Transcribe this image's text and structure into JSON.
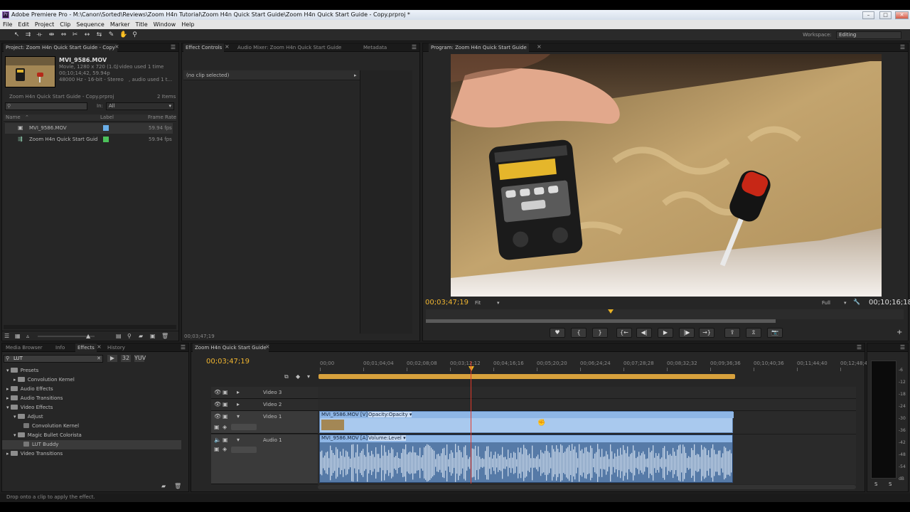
{
  "window": {
    "title": "Adobe Premiere Pro - M:\\Canon\\Sorted\\Reviews\\Zoom H4n Tutorial\\Zoom H4n Quick Start Guide\\Zoom H4n Quick Start Guide - Copy.prproj *",
    "controls": [
      "–",
      "□",
      "✕"
    ]
  },
  "menu": [
    "File",
    "Edit",
    "Project",
    "Clip",
    "Sequence",
    "Marker",
    "Title",
    "Window",
    "Help"
  ],
  "toolbar": {
    "tools": [
      "selection-tool-icon",
      "track-select-icon",
      "ripple-edit-icon",
      "rolling-edit-icon",
      "rate-stretch-icon",
      "razor-icon",
      "slip-icon",
      "slide-icon",
      "pen-icon",
      "hand-icon",
      "zoom-icon"
    ],
    "workspace_label": "Workspace:",
    "workspace_value": "Editing"
  },
  "project": {
    "tab": "Project: Zoom H4n Quick Start Guide - Copy",
    "clip_name": "MVI_9586.MOV",
    "clip_line1": "Movie, 1280 x 720 (1.0)",
    "clip_line1b": ", video used 1 time",
    "clip_line2": "00;10;14;42, 59.94p",
    "clip_line3": "48000 Hz - 16-bit - Stereo",
    "clip_line3b": ", audio used 1 t...",
    "file_name": "Zoom H4n Quick Start Guide - Copy.prproj",
    "item_count": "2 Items",
    "in_label": "In:",
    "in_value": "All",
    "col_name": "Name",
    "col_label": "Label",
    "col_rate": "Frame Rate",
    "items": [
      {
        "name": "MVI_9586.MOV",
        "rate": "59.94 fps",
        "color": "#6aaee8"
      },
      {
        "name": "Zoom H4n Quick Start Guid",
        "rate": "59.94 fps",
        "color": "#4cc15a"
      }
    ]
  },
  "effect_controls": {
    "tabs": [
      "Effect Controls",
      "Audio Mixer: Zoom H4n Quick Start Guide",
      "Metadata"
    ],
    "no_clip": "(no clip selected)",
    "timecode": "00;03;47;19"
  },
  "program": {
    "tab": "Program: Zoom H4n Quick Start Guide",
    "timecode": "00;03;47;19",
    "fit": "Fit",
    "quality": "Full",
    "duration": "00;10;16;18",
    "transport": [
      "♥",
      "{",
      "}",
      "{←",
      "◀|",
      "▶",
      "|▶",
      "→}",
      "⇪",
      "⇫",
      "📷"
    ]
  },
  "effects": {
    "tabs": [
      "Media Browser",
      "Info",
      "Effects",
      "History"
    ],
    "search": "LUT",
    "tree": [
      {
        "label": "Presets",
        "level": 0,
        "open": true
      },
      {
        "label": "Convolution Kernel",
        "level": 1,
        "open": false
      },
      {
        "label": "Audio Effects",
        "level": 0,
        "open": false
      },
      {
        "label": "Audio Transitions",
        "level": 0,
        "open": false
      },
      {
        "label": "Video Effects",
        "level": 0,
        "open": true
      },
      {
        "label": "Adjust",
        "level": 1,
        "open": true
      },
      {
        "label": "Convolution Kernel",
        "level": 2,
        "open": false
      },
      {
        "label": "Magic Bullet Colorista",
        "level": 1,
        "open": true
      },
      {
        "label": "LUT Buddy",
        "level": 2,
        "open": false
      },
      {
        "label": "Video Transitions",
        "level": 0,
        "open": false
      }
    ]
  },
  "timeline": {
    "tab": "Zoom H4n Quick Start Guide",
    "timecode": "00;03;47;19",
    "ruler": [
      "00;00",
      "00;01;04;04",
      "00;02;08;08",
      "00;03;12;12",
      "00;04;16;16",
      "00;05;20;20",
      "00;06;24;24",
      "00;07;28;28",
      "00;08;32;32",
      "00;09;36;36",
      "00;10;40;36",
      "00;11;44;40",
      "00;12;48;44"
    ],
    "tracks": [
      "Video 3",
      "Video 2",
      "Video 1",
      "Audio 1"
    ],
    "video_clip": "MVI_9586.MOV [V]",
    "video_fx": "Opacity:Opacity ▾",
    "audio_clip": "MVI_9586.MOV [A]",
    "audio_fx": "Volume:Level ▾"
  },
  "meter": {
    "labels": [
      "-6",
      "-12",
      "-18",
      "-24",
      "-30",
      "-36",
      "-42",
      "-48",
      "-54",
      "dB"
    ],
    "buttons": [
      "S",
      "S"
    ]
  },
  "status": "Drop onto a clip to apply the effect."
}
